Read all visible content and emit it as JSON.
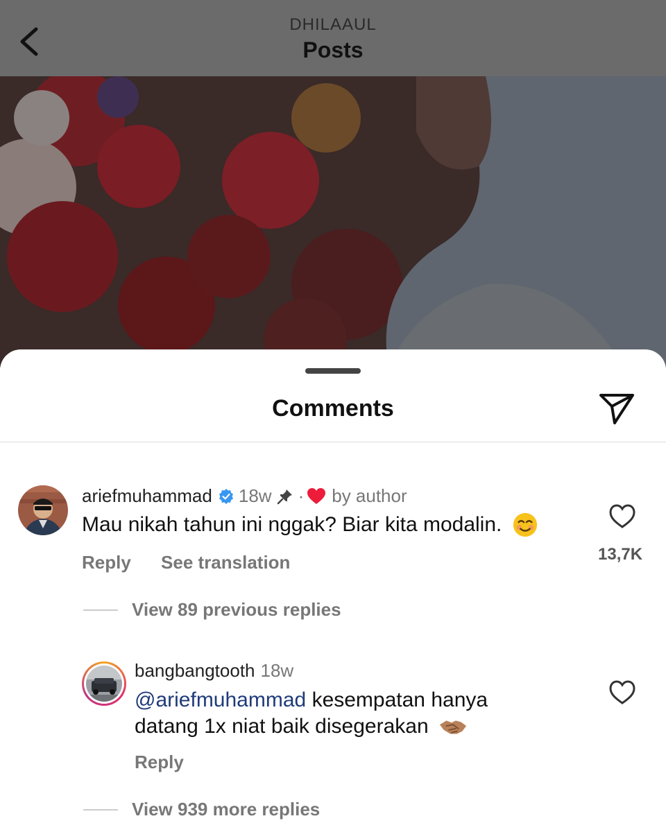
{
  "header": {
    "subtitle": "DHILAAUL",
    "title": "Posts"
  },
  "sheet": {
    "title": "Comments"
  },
  "comments": [
    {
      "username": "ariefmuhammad",
      "verified": true,
      "time": "18w",
      "pinned": true,
      "liked_by_author": "by author",
      "text": "Mau nikah tahun ini nggak? Biar kita modalin.",
      "emoji": "☺️",
      "reply_label": "Reply",
      "translate_label": "See translation",
      "like_count": "13,7K",
      "view_replies": "View 89 previous replies"
    },
    {
      "username": "bangbangtooth",
      "time": "18w",
      "mention": "@ariefmuhammad",
      "text_line1": "kesempatan hanya",
      "text_line2": "datang 1x  niat baik disegerakan",
      "emoji": "🤝",
      "reply_label": "Reply",
      "view_replies": "View 939 more replies"
    }
  ],
  "colors": {
    "topbar": "#6b6b6b",
    "verified": "#3897f0",
    "heart": "#ed1c3a"
  },
  "icons": {
    "back": "chevron-left-icon",
    "send": "send-icon",
    "like": "heart-outline-icon"
  }
}
